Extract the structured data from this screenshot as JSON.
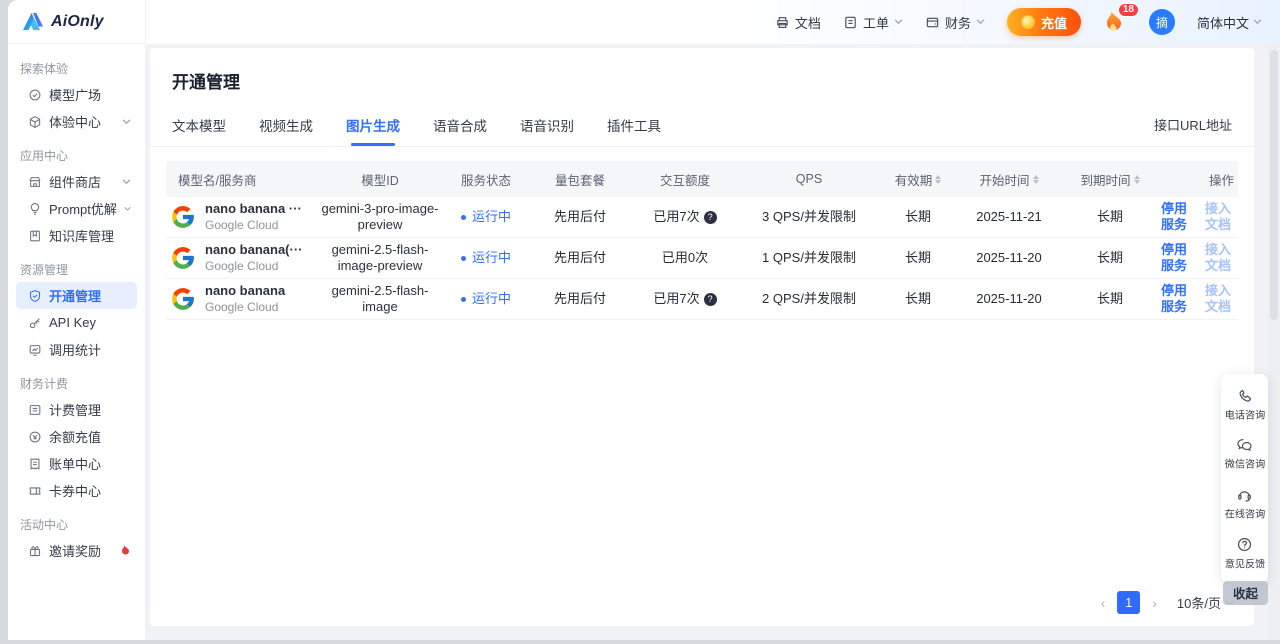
{
  "colors": {
    "primary": "#3370ff",
    "primary_light_bg": "#e7efff",
    "status_running": "#3370ff",
    "recharge_gradient_from": "#ffb21f",
    "recharge_gradient_to": "#ff4f0d",
    "badge_red": "#f53f3f",
    "link_disabled": "#a7c3f8"
  },
  "brand": {
    "name": "AiOnly"
  },
  "topnav": {
    "doc": {
      "label": "文档"
    },
    "workorder": {
      "label": "工单"
    },
    "finance": {
      "label": "财务"
    },
    "recharge_label": "充值",
    "fire_badge": "18",
    "avatar_text": "摘",
    "language": "简体中文"
  },
  "sidebar": {
    "sections": [
      {
        "title": "探索体验",
        "items": [
          {
            "label": "模型广场"
          },
          {
            "label": "体验中心",
            "expandable": true
          }
        ]
      },
      {
        "title": "应用中心",
        "items": [
          {
            "label": "组件商店",
            "expandable": true
          },
          {
            "label": "Prompt优解",
            "expandable": true
          },
          {
            "label": "知识库管理"
          }
        ]
      },
      {
        "title": "资源管理",
        "items": [
          {
            "label": "开通管理",
            "active": true
          },
          {
            "label": "API Key"
          },
          {
            "label": "调用统计"
          }
        ]
      },
      {
        "title": "财务计费",
        "items": [
          {
            "label": "计费管理"
          },
          {
            "label": "余额充值"
          },
          {
            "label": "账单中心"
          },
          {
            "label": "卡券中心"
          }
        ]
      },
      {
        "title": "活动中心",
        "items": [
          {
            "label": "邀请奖励",
            "hot": true
          }
        ]
      }
    ]
  },
  "page": {
    "title": "开通管理",
    "url_link": "接口URL地址",
    "tabs": [
      {
        "label": "文本模型"
      },
      {
        "label": "视频生成"
      },
      {
        "label": "图片生成",
        "active": true
      },
      {
        "label": "语音合成"
      },
      {
        "label": "语音识别"
      },
      {
        "label": "插件工具"
      }
    ]
  },
  "table": {
    "headers": [
      {
        "label": "模型名/服务商"
      },
      {
        "label": "模型ID"
      },
      {
        "label": "服务状态"
      },
      {
        "label": "量包套餐"
      },
      {
        "label": "交互额度"
      },
      {
        "label": "QPS"
      },
      {
        "label": "有效期",
        "sortable": true
      },
      {
        "label": "开始时间",
        "sortable": true
      },
      {
        "label": "到期时间",
        "sortable": true
      },
      {
        "label": "操作"
      }
    ],
    "rows": [
      {
        "name": "nano banana ···",
        "provider": "Google Cloud",
        "model_id": "gemini-3-pro-image-preview",
        "status": "运行中",
        "plan": "先用后付",
        "quota": "已用7次",
        "quota_info": true,
        "qps": "3 QPS/并发限制",
        "validity": "长期",
        "start_date": "2025-11-21",
        "expire_date": "长期",
        "action_stop": "停用服务",
        "action_doc": "接入文档"
      },
      {
        "name": "nano banana(···",
        "provider": "Google Cloud",
        "model_id": "gemini-2.5-flash-image-preview",
        "status": "运行中",
        "plan": "先用后付",
        "quota": "已用0次",
        "quota_info": false,
        "qps": "1 QPS/并发限制",
        "validity": "长期",
        "start_date": "2025-11-20",
        "expire_date": "长期",
        "action_stop": "停用服务",
        "action_doc": "接入文档"
      },
      {
        "name": "nano banana",
        "provider": "Google Cloud",
        "model_id": "gemini-2.5-flash-image",
        "status": "运行中",
        "plan": "先用后付",
        "quota": "已用7次",
        "quota_info": true,
        "qps": "2 QPS/并发限制",
        "validity": "长期",
        "start_date": "2025-11-20",
        "expire_date": "长期",
        "action_stop": "停用服务",
        "action_doc": "接入文档"
      }
    ]
  },
  "pagination": {
    "current": "1",
    "page_size": "10条/页"
  },
  "support": {
    "items": [
      {
        "label": "电话咨询"
      },
      {
        "label": "微信咨询"
      },
      {
        "label": "在线咨询"
      },
      {
        "label": "意见反馈"
      }
    ],
    "collapse_label": "收起"
  }
}
